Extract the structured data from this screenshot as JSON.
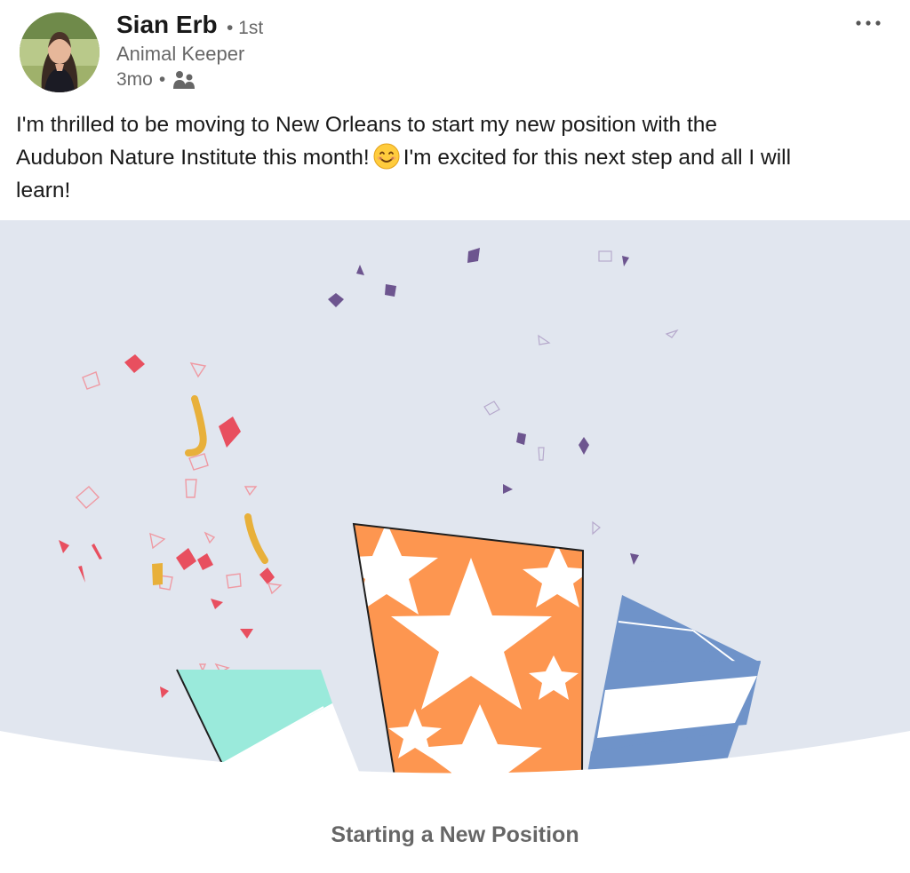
{
  "author": {
    "name": "Sian Erb",
    "degree": "• 1st",
    "headline": "Animal Keeper",
    "time": "3mo",
    "time_separator": "•",
    "visibility_icon": "connections-icon",
    "avatar_icon": "profile-photo"
  },
  "menu": {
    "icon": "more-horizontal-icon",
    "glyph": "•••"
  },
  "post": {
    "line1": "I'm thrilled to be moving to New Orleans to start my new position with the",
    "line2_before": "Audubon Nature Institute this month!",
    "emoji": "smiling-face-icon",
    "line2_after": "I'm excited for this next step and all I will",
    "line3": "learn!"
  },
  "illustration": {
    "name": "new-position-celebration-illustration",
    "colors": {
      "background": "#e1e6ef",
      "orange": "#fd9650",
      "teal": "#9aeadb",
      "blue": "#6f93c9",
      "confetti_red": "#e84f5f",
      "confetti_purple": "#6d558f",
      "confetti_yellow": "#e8b03a"
    }
  },
  "caption": "Starting a New Position"
}
